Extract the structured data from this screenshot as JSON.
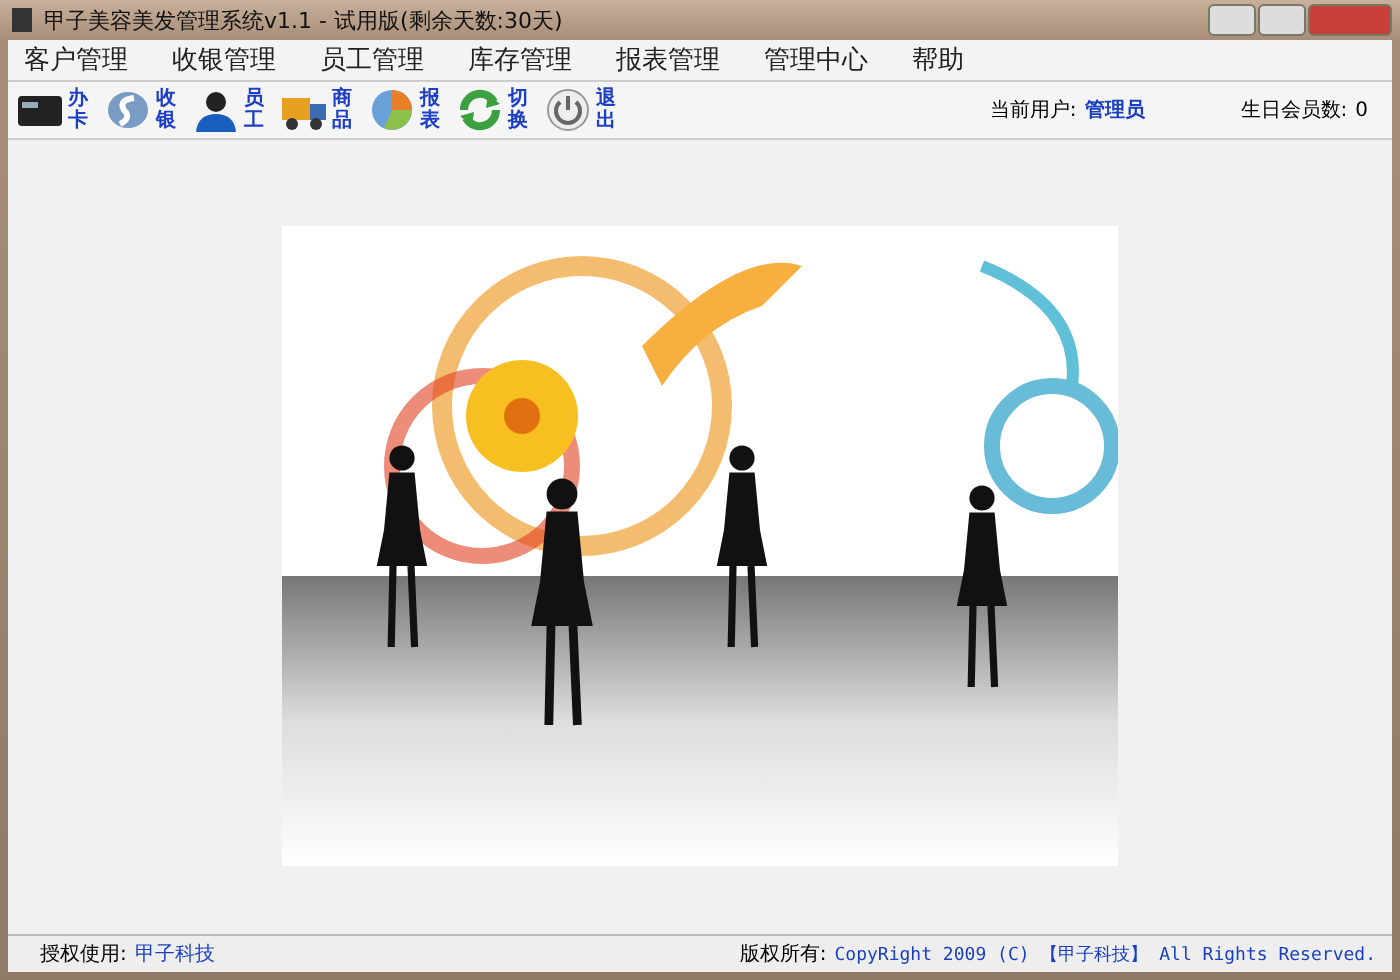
{
  "window": {
    "title": "甲子美容美发管理系统v1.1 - 试用版(剩余天数:30天)"
  },
  "menu": [
    "客户管理",
    "收银管理",
    "员工管理",
    "库存管理",
    "报表管理",
    "管理中心",
    "帮助"
  ],
  "toolbar": [
    {
      "label": "办卡",
      "kind": "card"
    },
    {
      "label": "收银",
      "kind": "cash"
    },
    {
      "label": "员工",
      "kind": "staff"
    },
    {
      "label": "商品",
      "kind": "truck"
    },
    {
      "label": "报表",
      "kind": "chart"
    },
    {
      "label": "切换",
      "kind": "switch"
    },
    {
      "label": "退出",
      "kind": "power"
    }
  ],
  "user": {
    "label": "当前用户:",
    "value": "管理员"
  },
  "birthday": {
    "label": "生日会员数:",
    "value": "0"
  },
  "status_bar": {
    "license_label": "授权使用:",
    "license_value": "甲子科技",
    "copyright_label": "版权所有:",
    "copyright_value": "CopyRight 2009 (C) 【甲子科技】 All Rights Reserved."
  }
}
